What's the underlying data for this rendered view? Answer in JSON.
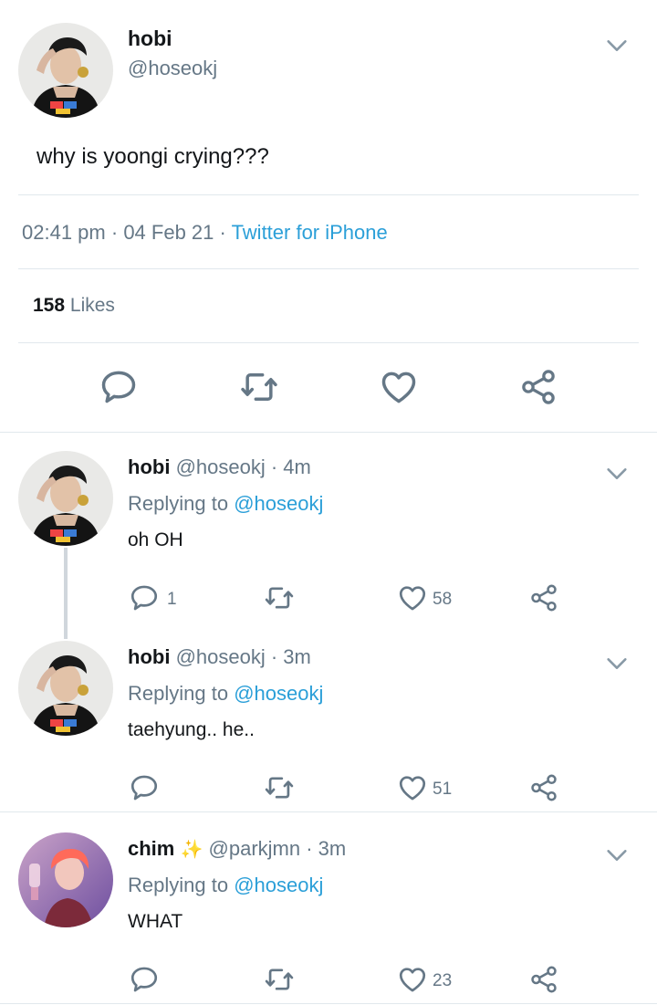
{
  "main_tweet": {
    "display_name": "hobi",
    "handle": "@hoseokj",
    "text": "why is yoongi crying???",
    "time": "02:41 pm",
    "date": "04 Feb 21",
    "source": "Twitter for iPhone",
    "likes_count": "158",
    "likes_label": "Likes"
  },
  "replies": [
    {
      "display_name": "hobi",
      "handle": "@hoseokj",
      "time": "· 4m",
      "replying_label": "Replying to",
      "replying_to": "@hoseokj",
      "text": "oh OH",
      "reply_count": "1",
      "retweet_count": "",
      "like_count": "58"
    },
    {
      "display_name": "hobi",
      "handle": "@hoseokj",
      "time": "· 3m",
      "replying_label": "Replying to",
      "replying_to": "@hoseokj",
      "text": "taehyung.. he..",
      "reply_count": "",
      "retweet_count": "",
      "like_count": "51"
    },
    {
      "display_name": "chim",
      "emoji": "✨",
      "handle": "@parkjmn",
      "time": "· 3m",
      "replying_label": "Replying to",
      "replying_to": "@hoseokj",
      "text": "WHAT",
      "reply_count": "",
      "retweet_count": "",
      "like_count": "23"
    }
  ],
  "icons": {
    "reply": "reply-icon",
    "retweet": "retweet-icon",
    "like": "heart-icon",
    "share": "share-icon",
    "more": "chevron-down-icon"
  },
  "colors": {
    "link": "#2b9fd8",
    "secondary_text": "#657786",
    "icon": "#657786",
    "divider": "#e1e8ed"
  }
}
